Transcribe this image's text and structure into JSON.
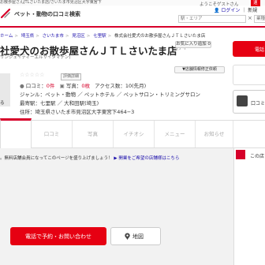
{
  "top_bar": {
    "breadcrumb_text": "お散歩屋さんJTLさいたま店/さいたま市見沼区大字東宮下",
    "welcome": "ようこそゲストさん",
    "sokuho": "速"
  },
  "header": {
    "site_name": "ペット・動物の口コミ検索",
    "area_placeholder": "駅・エリア",
    "keyword_placeholder": "業種・店名・キー",
    "login": "ログイン",
    "signup": "新規"
  },
  "breadcrumb": [
    "ホーム",
    "埼玉県",
    "さいたま市",
    "見沼区",
    "七里駅",
    "株式会社愛犬のお散歩屋さんＪＴＬさいたま店"
  ],
  "shop": {
    "title": "社愛犬のお散歩屋さんＪＴＬさいたま店",
    "title_tail": "(アイ",
    "kana": "サンジェイティーエルサイタマテン)",
    "favorite_button": "お気に入り追加",
    "favorite_count": "0",
    "fix_button": "▼店舗情報修正依頼",
    "photo_button": "る",
    "stars": "☆☆☆☆☆",
    "rating_label": "評価詳細",
    "review_label": "口コミ",
    "review_count": "0件",
    "photo_label": "写真",
    "photo_count": "0枚",
    "access_label": "アクセス数",
    "access_count": "10(先月)",
    "genre": "ジャンル：ペット・動物 ／ ペットホテル ／ ペットサロン・トリミングサロン",
    "station": "最寄駅：七里駅 ／ 大和田駅(埼玉)",
    "address": "住所：埼玉県さいたま市見沼区大字東宮下464−3"
  },
  "tabs": [
    "",
    "口コミ",
    "写真",
    "イチオシ",
    "メニュー",
    "お知らせ"
  ],
  "notice": {
    "text_a": "。無料店舗会員になってこのページを盛り上げましょう！",
    "link": "▶ 開業をご希望の店舗様はこちら"
  },
  "side": {
    "tel_top": "電話",
    "review_post": "口コミ投稿",
    "panel_text": "この店"
  },
  "actions": {
    "tel_reserve": "電話で予約・お問い合わせ",
    "map": "地図"
  },
  "colors": {
    "accent": "#e60012",
    "rule": "#d6002a",
    "link": "#1a0dab"
  }
}
